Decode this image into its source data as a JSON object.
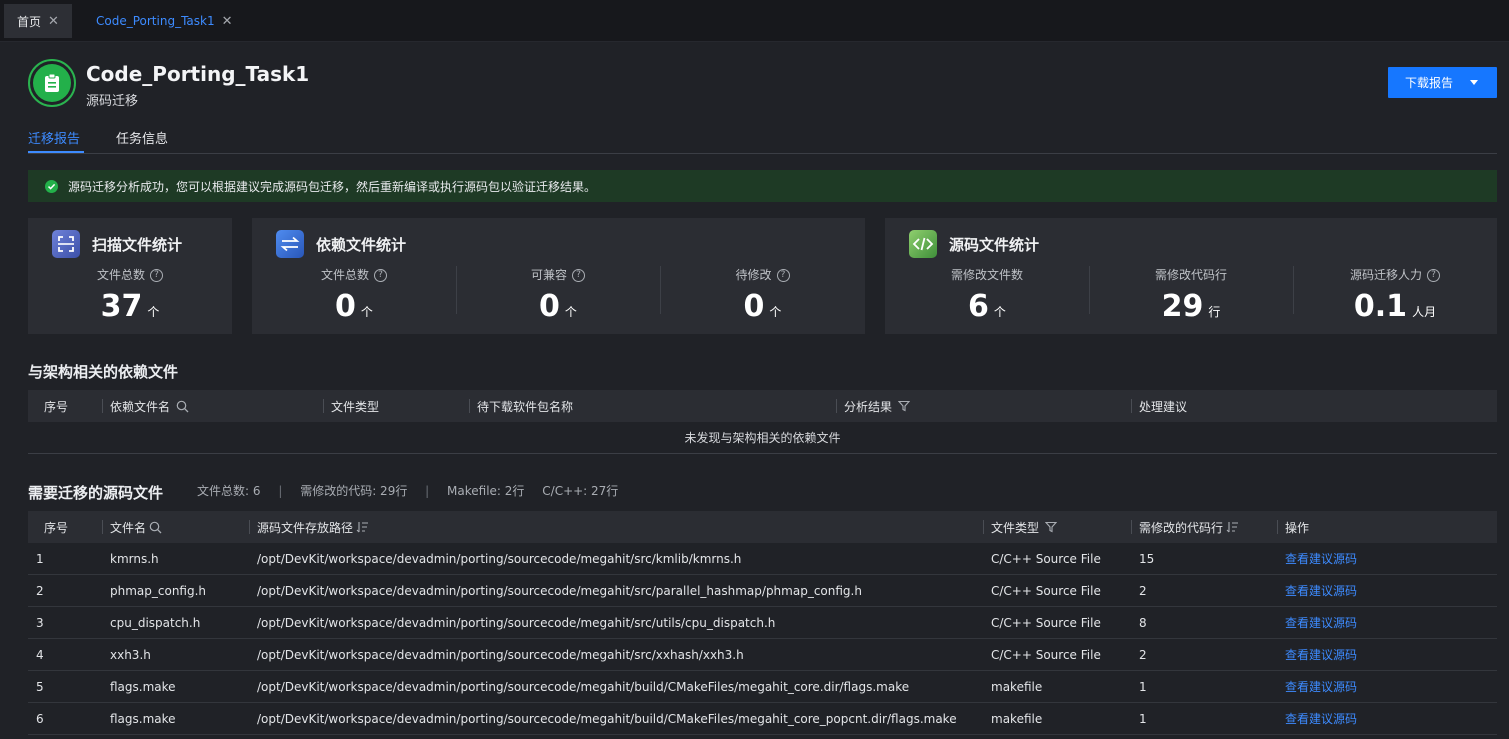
{
  "tabs": [
    {
      "label": "首页"
    },
    {
      "label": "Code_Porting_Task1"
    }
  ],
  "header": {
    "title": "Code_Porting_Task1",
    "subtitle": "源码迁移",
    "download_label": "下载报告"
  },
  "nav": {
    "tab1": "迁移报告",
    "tab2": "任务信息"
  },
  "alert": {
    "text": "源码迁移分析成功，您可以根据建议完成源码包迁移，然后重新编译或执行源码包以验证迁移结果。"
  },
  "scan_card": {
    "title": "扫描文件统计",
    "stats": [
      {
        "label": "文件总数",
        "value": "37",
        "unit": "个"
      }
    ]
  },
  "dep_card": {
    "title": "依赖文件统计",
    "stats": [
      {
        "label": "文件总数",
        "value": "0",
        "unit": "个"
      },
      {
        "label": "可兼容",
        "value": "0",
        "unit": "个"
      },
      {
        "label": "待修改",
        "value": "0",
        "unit": "个"
      }
    ]
  },
  "src_card": {
    "title": "源码文件统计",
    "stats": [
      {
        "label": "需修改文件数",
        "value": "6",
        "unit": "个"
      },
      {
        "label": "需修改代码行",
        "value": "29",
        "unit": "行"
      },
      {
        "label": "源码迁移人力",
        "value": "0.1",
        "unit": "人月"
      }
    ]
  },
  "dep_table": {
    "title": "与架构相关的依赖文件",
    "columns": [
      "序号",
      "依赖文件名",
      "文件类型",
      "待下载软件包名称",
      "分析结果",
      "处理建议"
    ],
    "empty_text": "未发现与架构相关的依赖文件"
  },
  "src_table": {
    "title": "需要迁移的源码文件",
    "summary": {
      "total": "文件总数:  6",
      "lines": "需修改的代码: 29行",
      "makefile": "Makefile: 2行",
      "cpp": "C/C++: 27行"
    },
    "columns": [
      "序号",
      "文件名",
      "源码文件存放路径",
      "文件类型",
      "需修改的代码行",
      "操作"
    ],
    "rows": [
      {
        "no": "1",
        "name": "kmrns.h",
        "path": "/opt/DevKit/workspace/devadmin/porting/sourcecode/megahit/src/kmlib/kmrns.h",
        "type": "C/C++ Source File",
        "lines": "15",
        "action": "查看建议源码"
      },
      {
        "no": "2",
        "name": "phmap_config.h",
        "path": "/opt/DevKit/workspace/devadmin/porting/sourcecode/megahit/src/parallel_hashmap/phmap_config.h",
        "type": "C/C++ Source File",
        "lines": "2",
        "action": "查看建议源码"
      },
      {
        "no": "3",
        "name": "cpu_dispatch.h",
        "path": "/opt/DevKit/workspace/devadmin/porting/sourcecode/megahit/src/utils/cpu_dispatch.h",
        "type": "C/C++ Source File",
        "lines": "8",
        "action": "查看建议源码"
      },
      {
        "no": "4",
        "name": "xxh3.h",
        "path": "/opt/DevKit/workspace/devadmin/porting/sourcecode/megahit/src/xxhash/xxh3.h",
        "type": "C/C++ Source File",
        "lines": "2",
        "action": "查看建议源码"
      },
      {
        "no": "5",
        "name": "flags.make",
        "path": "/opt/DevKit/workspace/devadmin/porting/sourcecode/megahit/build/CMakeFiles/megahit_core.dir/flags.make",
        "type": "makefile",
        "lines": "1",
        "action": "查看建议源码"
      },
      {
        "no": "6",
        "name": "flags.make",
        "path": "/opt/DevKit/workspace/devadmin/porting/sourcecode/megahit/build/CMakeFiles/megahit_core_popcnt.dir/flags.make",
        "type": "makefile",
        "lines": "1",
        "action": "查看建议源码"
      }
    ]
  },
  "colors": {
    "accent": "#1677ff",
    "link": "#3d8bff",
    "success": "#23b04a",
    "alert_bg": "#1e3a25"
  },
  "icons": [
    "close-icon",
    "clipboard-icon",
    "caret-down-icon",
    "check-circle-icon",
    "scan-icon",
    "exchange-icon",
    "code-icon",
    "help-icon",
    "search-icon",
    "filter-icon",
    "sort-icon"
  ]
}
